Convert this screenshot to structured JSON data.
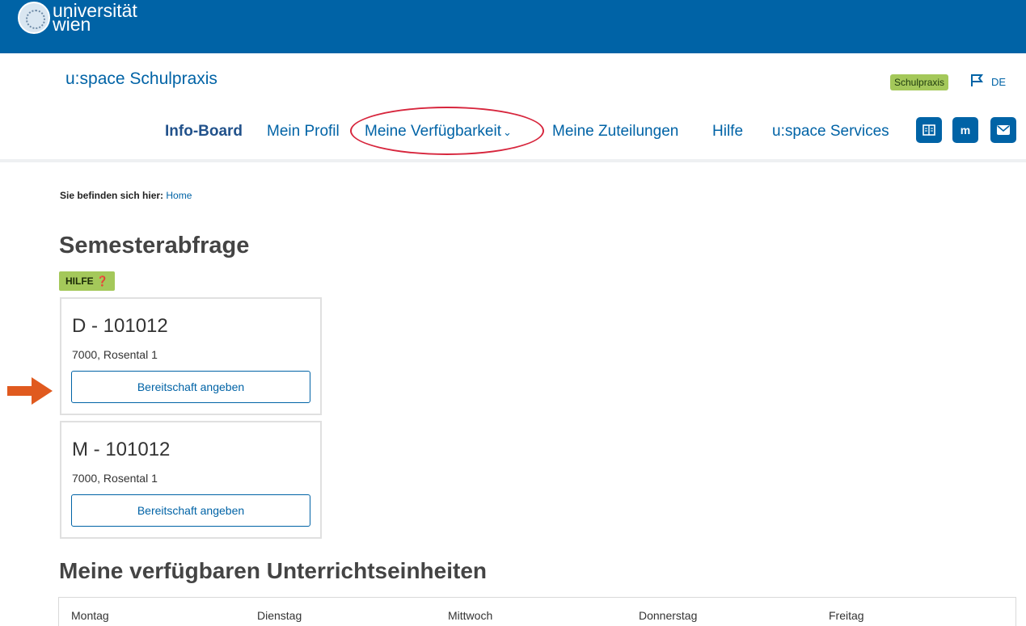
{
  "brand": {
    "line1": "universität",
    "line2": "wien"
  },
  "header": {
    "app_title": "u:space Schulpraxis",
    "badge": "Schulpraxis",
    "language": "DE"
  },
  "nav": {
    "items": [
      {
        "label": "Info-Board",
        "active": true
      },
      {
        "label": "Mein Profil"
      },
      {
        "label": "Meine Verfügbarkeit",
        "has_dropdown": true
      },
      {
        "label": "Meine Zuteilungen"
      },
      {
        "label": "Hilfe"
      },
      {
        "label": "u:space Services"
      }
    ],
    "icon_buttons": [
      "handbook-icon",
      "moodle-icon",
      "mail-icon"
    ]
  },
  "breadcrumb": {
    "prefix": "Sie befinden sich hier:",
    "home": "Home"
  },
  "semester": {
    "title": "Semesterabfrage",
    "help_label": "HILFE",
    "cards": [
      {
        "code": "D - 101012",
        "address": "7000, Rosental 1",
        "button": "Bereitschaft angeben"
      },
      {
        "code": "M - 101012",
        "address": "7000, Rosental 1",
        "button": "Bereitschaft angeben"
      }
    ]
  },
  "availability": {
    "title": "Meine verfügbaren Unterrichtseinheiten",
    "days": [
      "Montag",
      "Dienstag",
      "Mittwoch",
      "Donnerstag",
      "Freitag"
    ]
  },
  "colors": {
    "brand_blue": "#0063a6",
    "badge_green": "#a4c85a",
    "annotation_red": "#d7263d",
    "arrow_orange": "#e05a1f"
  }
}
